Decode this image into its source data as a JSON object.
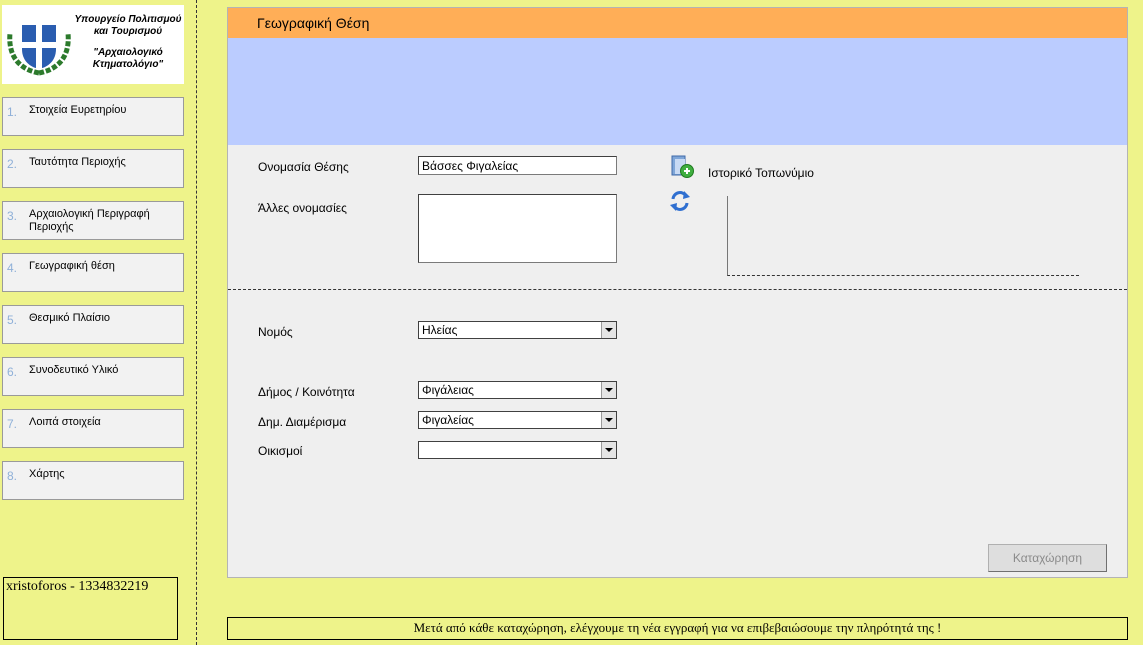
{
  "logo": {
    "line1": "Υπουργείο Πολιτισμού",
    "line2": "και Τουρισμού",
    "line3": "\"Αρχαιολογικό",
    "line4": "Κτηματολόγιο\""
  },
  "sidebar": {
    "items": [
      {
        "num": "1.",
        "label": "Στοιχεία Ευρετηρίου"
      },
      {
        "num": "2.",
        "label": "Ταυτότητα Περιοχής"
      },
      {
        "num": "3.",
        "label": "Αρχαιολογική Περιγραφή Περιοχής"
      },
      {
        "num": "4.",
        "label": "Γεωγραφική θέση"
      },
      {
        "num": "5.",
        "label": "Θεσμικό Πλαίσιο"
      },
      {
        "num": "6.",
        "label": "Συνοδευτικό Υλικό"
      },
      {
        "num": "7.",
        "label": "Λοιπά στοιχεία"
      },
      {
        "num": "8.",
        "label": "Χάρτης"
      }
    ]
  },
  "user": {
    "text": "xristoforos - 1334832219"
  },
  "panel": {
    "title": "Γεωγραφική Θέση"
  },
  "form": {
    "name_label": "Ονομασία Θέσης",
    "name_value": "Βάσσες Φιγαλείας",
    "other_names_label": "Άλλες ονομασίες",
    "other_names_value": "",
    "historic_label": "Ιστορικό Τοπωνύμιο",
    "nomos_label": "Νομός",
    "nomos_value": "Ηλείας",
    "dimos_label": "Δήμος / Κοινότητα",
    "dimos_value": "Φιγάλειας",
    "diamerisma_label": "Δημ. Διαμέρισμα",
    "diamerisma_value": "Φιγαλείας",
    "oikismoi_label": "Οικισμοί",
    "oikismoi_value": ""
  },
  "actions": {
    "submit_label": "Καταχώρηση"
  },
  "footer": {
    "message": "Μετά από κάθε καταχώρηση, ελέγχουμε τη νέα εγγραφή για να επιβεβαιώσουμε την πληρότητά της !"
  },
  "colors": {
    "page_bg": "#eef38a",
    "header_orange": "#ffae57",
    "band_blue": "#bbccff",
    "panel_gray": "#efefef"
  },
  "icons": [
    "emblem-logo",
    "add-document-icon",
    "refresh-icon",
    "dropdown-arrow-icon"
  ]
}
